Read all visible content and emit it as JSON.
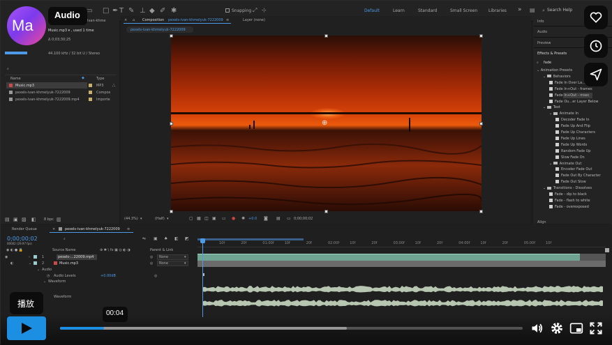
{
  "badge": {
    "initials": "Ma",
    "title": "Audio"
  },
  "topbar": {
    "snapping": "Snapping",
    "workspaces": [
      "Default",
      "Learn",
      "Standard",
      "Small Screen",
      "Libraries"
    ],
    "more": "»",
    "search_help": "Search Help",
    "partial_title": "Ivan-khme"
  },
  "project": {
    "file_name": "Music.mp3 ▾ , used 1 time",
    "duration": "Δ 0;03;30;25",
    "audio_info": "44.100 kHz / 32 bit U / Stereo",
    "columns": {
      "name": "Name",
      "type": "Type"
    },
    "items": [
      {
        "name": "Music.mp3",
        "type": "MP3"
      },
      {
        "name": "pexels-ivan-khmelyuk-7222009",
        "type": "Compos"
      },
      {
        "name": "pexels-ivan-khmelyuk-7222009.mp4",
        "type": "Importe"
      }
    ],
    "bpc": "8 bpc"
  },
  "composition": {
    "tab_prefix": "Composition",
    "tab_name": "pexels-ivan-khmelyuk-7222009",
    "layer_tab": "Layer (none)",
    "crumb": "pexels-ivan-khmelyuk-7222009",
    "zoom": "(44.3%)",
    "quality": "(Half)",
    "exposure": "+0.0",
    "timecode": "0;00;00;02"
  },
  "right_panel": {
    "info": "Info",
    "audio": "Audio",
    "preview": "Preview",
    "effects_presets": "Effects & Presets",
    "search_value": "fade",
    "tree": [
      {
        "label": "Animation Presets",
        "level": 0,
        "kind": "root"
      },
      {
        "label": "Behaviors",
        "level": 1,
        "kind": "folder"
      },
      {
        "label": "Fade In Over La...",
        "level": 2,
        "kind": "preset"
      },
      {
        "label": "Fade In+Out - frames",
        "level": 2,
        "kind": "preset"
      },
      {
        "label": "Fade In+Out - msec",
        "level": 2,
        "kind": "preset",
        "selected": true
      },
      {
        "label": "Fade Ou...er Layer Below",
        "level": 2,
        "kind": "preset"
      },
      {
        "label": "Text",
        "level": 1,
        "kind": "folder"
      },
      {
        "label": "Animate In",
        "level": 2,
        "kind": "folder"
      },
      {
        "label": "Decoder Fade In",
        "level": 3,
        "kind": "preset"
      },
      {
        "label": "Fade Up And Flip",
        "level": 3,
        "kind": "preset"
      },
      {
        "label": "Fade Up Characters",
        "level": 3,
        "kind": "preset"
      },
      {
        "label": "Fade Up Lines",
        "level": 3,
        "kind": "preset"
      },
      {
        "label": "Fade Up Words",
        "level": 3,
        "kind": "preset"
      },
      {
        "label": "Random Fade Up",
        "level": 3,
        "kind": "preset"
      },
      {
        "label": "Slow Fade On",
        "level": 3,
        "kind": "preset"
      },
      {
        "label": "Animate Out",
        "level": 2,
        "kind": "folder"
      },
      {
        "label": "Encoder Fade Out",
        "level": 3,
        "kind": "preset"
      },
      {
        "label": "Fade Out By Character",
        "level": 3,
        "kind": "preset"
      },
      {
        "label": "Fade Out Slow",
        "level": 3,
        "kind": "preset"
      },
      {
        "label": "Transitions - Dissolves",
        "level": 1,
        "kind": "folder"
      },
      {
        "label": "Fade - dip to black",
        "level": 2,
        "kind": "preset"
      },
      {
        "label": "Fade - flash to white",
        "level": 2,
        "kind": "preset"
      },
      {
        "label": "Fade - overexposed",
        "level": 2,
        "kind": "preset"
      }
    ],
    "bottom_cut": "Align"
  },
  "timeline": {
    "render_queue": "Render Queue",
    "tab_name": "pexels-ivan-khmelyuk-7222009",
    "timecode": "0;00;00;02",
    "frame_info": "00002 (29.97 fps)",
    "columns": {
      "source": "Source Name",
      "parent": "Parent & Link"
    },
    "layers": [
      {
        "num": "1",
        "name": "pexels-...22009.mp4",
        "parent": "None"
      },
      {
        "num": "2",
        "name": "Music.mp3",
        "parent": "None"
      }
    ],
    "audio_group": "Audio",
    "audio_levels_label": "Audio Levels",
    "audio_levels_value": "+0.00dB",
    "waveform_label": "Waveform",
    "waveform_label2": "Waveform",
    "ruler": [
      "10f",
      "20f",
      "01:00f",
      "10f",
      "20f",
      "02:00f",
      "10f",
      "20f",
      "03:00f",
      "10f",
      "20f",
      "04:00f",
      "10f",
      "20f",
      "05:00f",
      "10f"
    ]
  },
  "player": {
    "play_tooltip": "播放",
    "time_tooltip": "00:04",
    "progress_fraction": 0.095,
    "buffer_fraction": 0.62
  },
  "colors": {
    "accent": "#4d9be8",
    "player_blue": "#1c8fe3",
    "track_green": "#6fa392"
  }
}
